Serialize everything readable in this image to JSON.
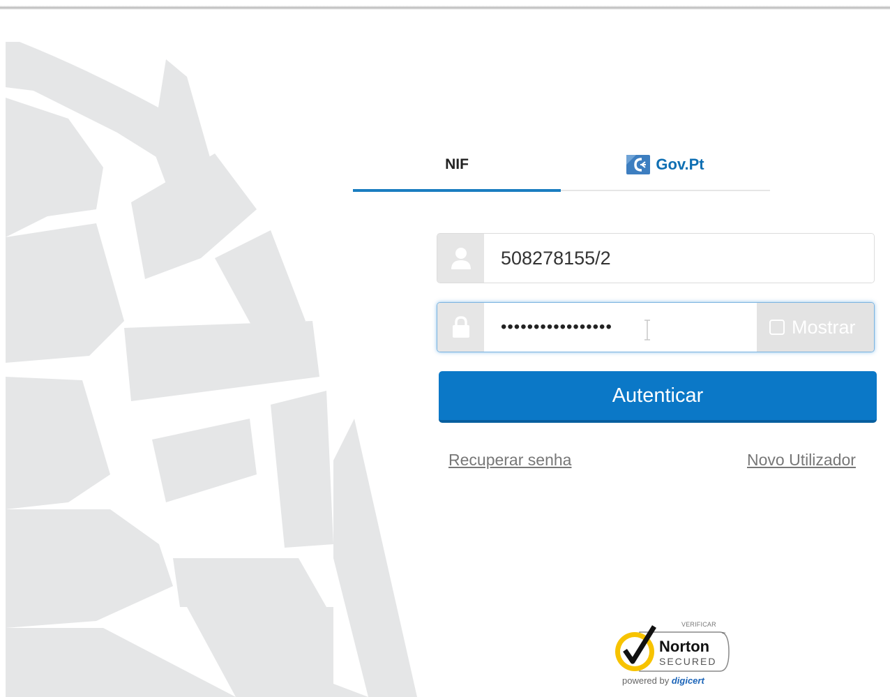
{
  "tabs": {
    "nif_label": "NIF",
    "gov_label": "Gov.Pt",
    "active": "NIF"
  },
  "login": {
    "nif_value": "508278155/2",
    "password_masked": "•••••••••••••••••",
    "show_password_label": "Mostrar",
    "show_password_checked": false,
    "submit_label": "Autenticar"
  },
  "links": {
    "recover_password": "Recuperar senha",
    "new_user": "Novo Utilizador"
  },
  "seal": {
    "verify_label": "VERIFICAR",
    "brand": "Norton",
    "secured": "SECURED",
    "powered_by": "powered by",
    "provider": "digicert"
  },
  "icons": {
    "user": "user-icon",
    "lock": "lock-icon",
    "gov": "gov-pt-icon",
    "check": "checkmark-icon"
  },
  "colors": {
    "primary": "#0b78c7",
    "gov_blue": "#0f6fb3",
    "addon_gray": "#e6e6e6",
    "link_gray": "#777777",
    "norton_yellow": "#f7c300"
  }
}
